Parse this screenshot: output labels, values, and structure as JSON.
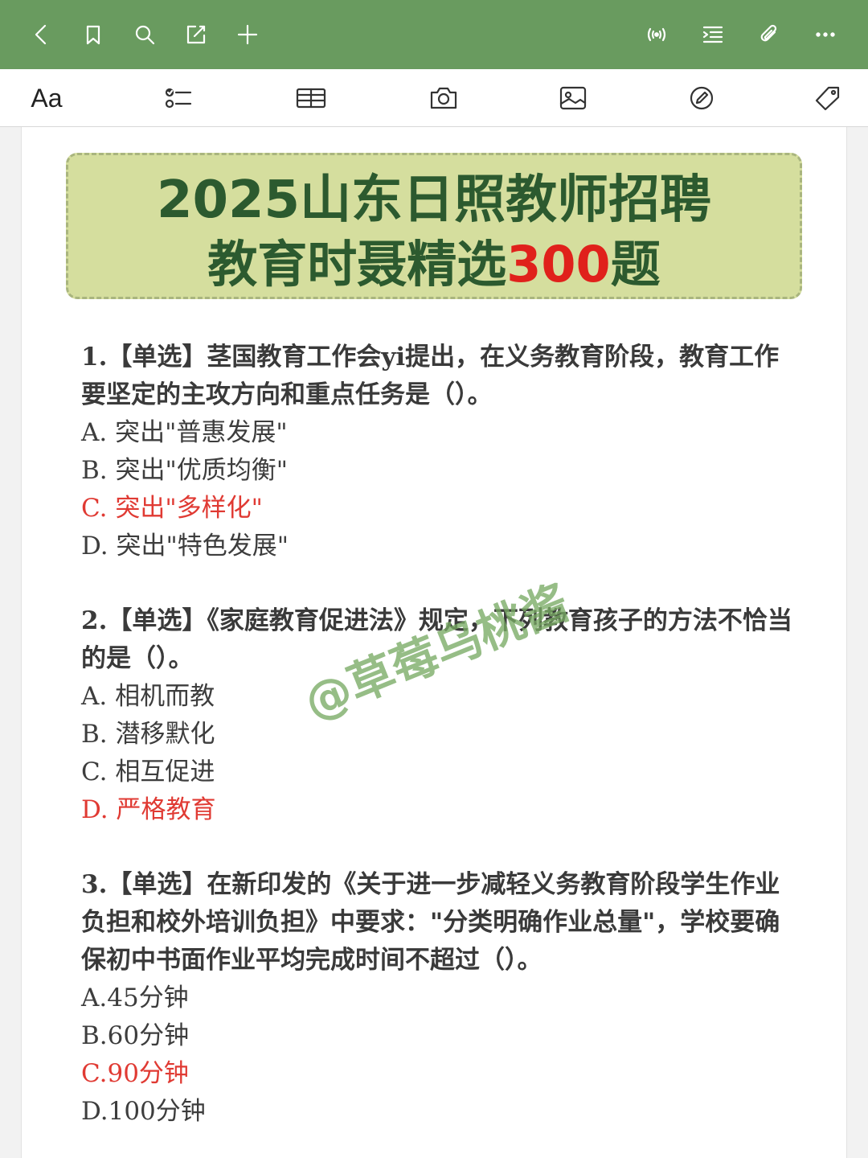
{
  "topbar": {
    "left_icons": [
      "back-icon",
      "bookmark-icon",
      "search-icon",
      "edit-icon",
      "add-icon"
    ],
    "right_icons": [
      "audio-icon",
      "outline-icon",
      "attachment-icon",
      "more-icon"
    ],
    "bg_color": "#699b5f"
  },
  "format_toolbar": {
    "text_style_label": "Aa",
    "icons": [
      "text-style-icon",
      "checklist-icon",
      "table-icon",
      "camera-icon",
      "image-icon",
      "draw-icon",
      "tag-icon"
    ]
  },
  "banner": {
    "line1": "2025山东日照教师招聘",
    "line2_prefix": "教育时聂精选",
    "line2_highlight": "300",
    "line2_suffix": "题",
    "bg_color": "#d5de9e",
    "text_color": "#2c5a2f",
    "highlight_color": "#e0211b"
  },
  "questions": [
    {
      "stem_line1": "1.【单选】茎国教育工作会yi提出，在义务教育阶段，教育工作",
      "stem_line2": "要坚定的主攻方向和重点任务是（）。",
      "options": [
        "A.  突出\"普惠发展\"",
        "B.  突出\"优质均衡\"",
        "C.  突出\"多样化\"",
        "D.  突出\"特色发展\""
      ],
      "correct": "C"
    },
    {
      "stem_line1": "2.【单选】《家庭教育促进法》规定，下列教育孩子的方法不恰当",
      "stem_line2": "的是（）。",
      "options": [
        "A.  相机而教",
        "B.  潜移默化",
        "C.  相互促进",
        "D.  严格教育"
      ],
      "correct": "D"
    },
    {
      "stem_line1": "3.【单选】在新印发的《关于进一步减轻义务教育阶段学生作业",
      "stem_line2": "负担和校外培训负担》中要求：\"分类明确作业总量\"，学校要确",
      "stem_line3": "保初中书面作业平均完成时间不超过（）。",
      "options": [
        "A.45分钟",
        "B.60分钟",
        "C.90分钟",
        "D.100分钟"
      ],
      "correct": "C"
    }
  ],
  "watermark": "@草莓乌桃酱",
  "answer_color": "#e03a33"
}
